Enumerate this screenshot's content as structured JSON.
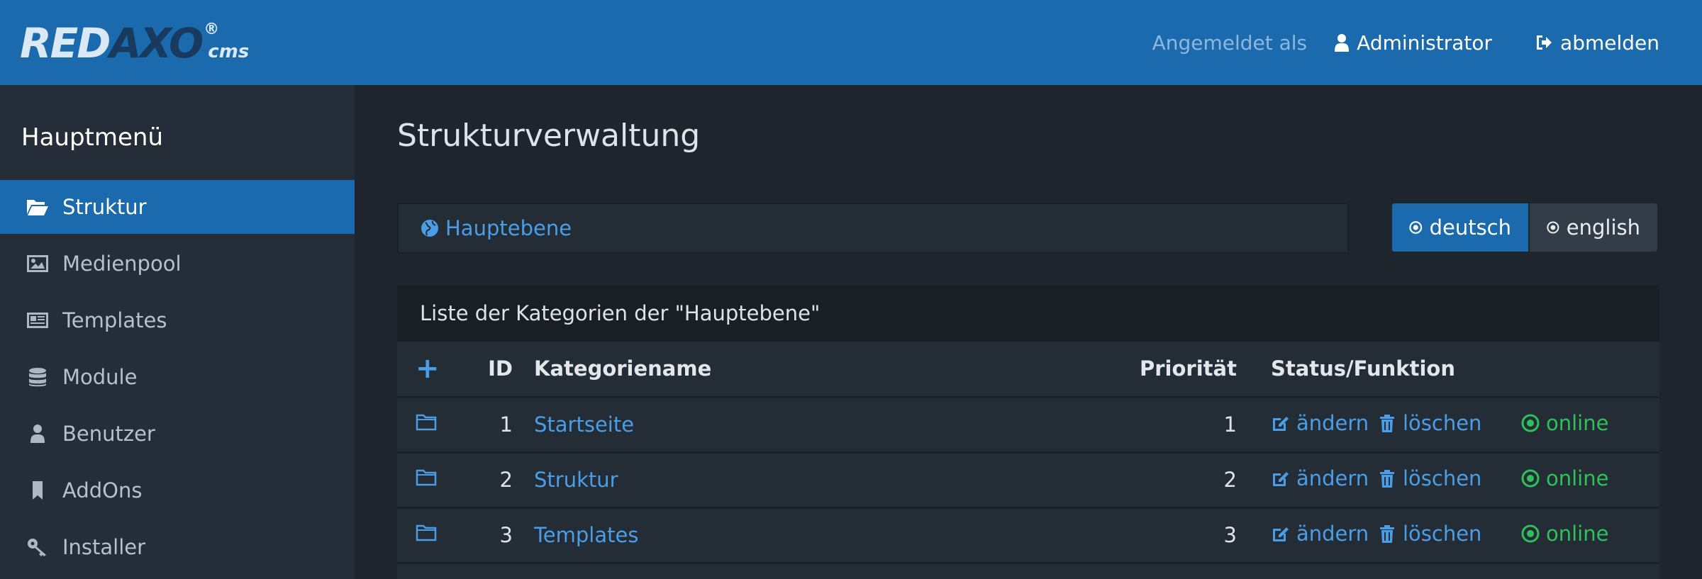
{
  "header": {
    "logo_main": "RED",
    "logo_axo": "AXO",
    "logo_reg": "®",
    "logo_cms": "cms",
    "logged_in_label": "Angemeldet als",
    "user_name": "Administrator",
    "logout_label": "abmelden"
  },
  "sidebar": {
    "title": "Hauptmenü",
    "items": [
      {
        "label": "Struktur",
        "icon": "folder-open-icon",
        "active": true
      },
      {
        "label": "Medienpool",
        "icon": "image-icon",
        "active": false
      },
      {
        "label": "Templates",
        "icon": "newspaper-icon",
        "active": false
      },
      {
        "label": "Module",
        "icon": "database-icon",
        "active": false
      },
      {
        "label": "Benutzer",
        "icon": "user-icon",
        "active": false
      },
      {
        "label": "AddOns",
        "icon": "bookmark-icon",
        "active": false
      },
      {
        "label": "Installer",
        "icon": "key-icon",
        "active": false
      }
    ]
  },
  "main": {
    "title": "Strukturverwaltung",
    "breadcrumb": "Hauptebene",
    "languages": [
      {
        "label": "deutsch",
        "active": true
      },
      {
        "label": "english",
        "active": false
      }
    ],
    "panel_heading": "Liste der Kategorien der \"Hauptebene\"",
    "table": {
      "headers": {
        "add": "+",
        "id": "ID",
        "name": "Kategoriename",
        "priority": "Priorität",
        "status": "Status/Funktion"
      },
      "rows": [
        {
          "id": "1",
          "name": "Startseite",
          "priority": "1",
          "edit": "ändern",
          "delete": "löschen",
          "status": "online"
        },
        {
          "id": "2",
          "name": "Struktur",
          "priority": "2",
          "edit": "ändern",
          "delete": "löschen",
          "status": "online"
        },
        {
          "id": "3",
          "name": "Templates",
          "priority": "3",
          "edit": "ändern",
          "delete": "löschen",
          "status": "online"
        }
      ]
    }
  },
  "colors": {
    "header_bg": "#1a6aad",
    "sidebar_bg": "#252e38",
    "main_bg": "#1e252d",
    "link": "#4a9ee8",
    "online": "#2ec05a"
  }
}
